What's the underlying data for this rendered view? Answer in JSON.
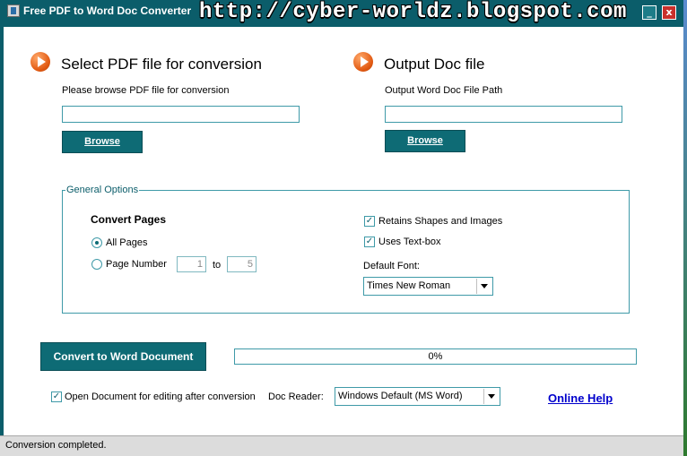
{
  "window": {
    "title": "Free PDF to Word Doc Converter",
    "banner": "http://cyber-worldz.blogspot.com",
    "minimize_glyph": "_",
    "close_glyph": "x"
  },
  "input_section": {
    "heading": "Select PDF file for conversion",
    "sublabel": "Please browse PDF file for conversion",
    "path_value": "",
    "browse_label": "Browse"
  },
  "output_section": {
    "heading": "Output Doc file",
    "sublabel": "Output Word Doc File Path",
    "path_value": "",
    "browse_label": "Browse"
  },
  "general_options": {
    "legend": "General Options",
    "convert_pages_label": "Convert Pages",
    "all_pages_label": "All Pages",
    "page_number_label": "Page Number",
    "page_from": "1",
    "to_label": "to",
    "page_to": "5",
    "selected_mode": "all_pages",
    "retain_shapes_label": "Retains Shapes and Images",
    "retain_shapes_checked": true,
    "use_textbox_label": "Uses Text-box",
    "use_textbox_checked": true,
    "default_font_label": "Default Font:",
    "default_font_value": "Times New Roman"
  },
  "actions": {
    "convert_label": "Convert to Word Document",
    "progress_percent": 0,
    "progress_text": "0%"
  },
  "footer_options": {
    "open_doc_label": "Open Document for editing after conversion",
    "open_doc_checked": true,
    "doc_reader_label": "Doc Reader:",
    "doc_reader_value": "Windows Default (MS Word)",
    "online_help_label": "Online Help"
  },
  "status": {
    "text": "Conversion completed."
  },
  "colors": {
    "frame": "#0b5d6a",
    "button": "#0e6b75",
    "border_accent": "#3f9aa8",
    "link": "#0000cc",
    "heading_icon": "#e25a12"
  }
}
